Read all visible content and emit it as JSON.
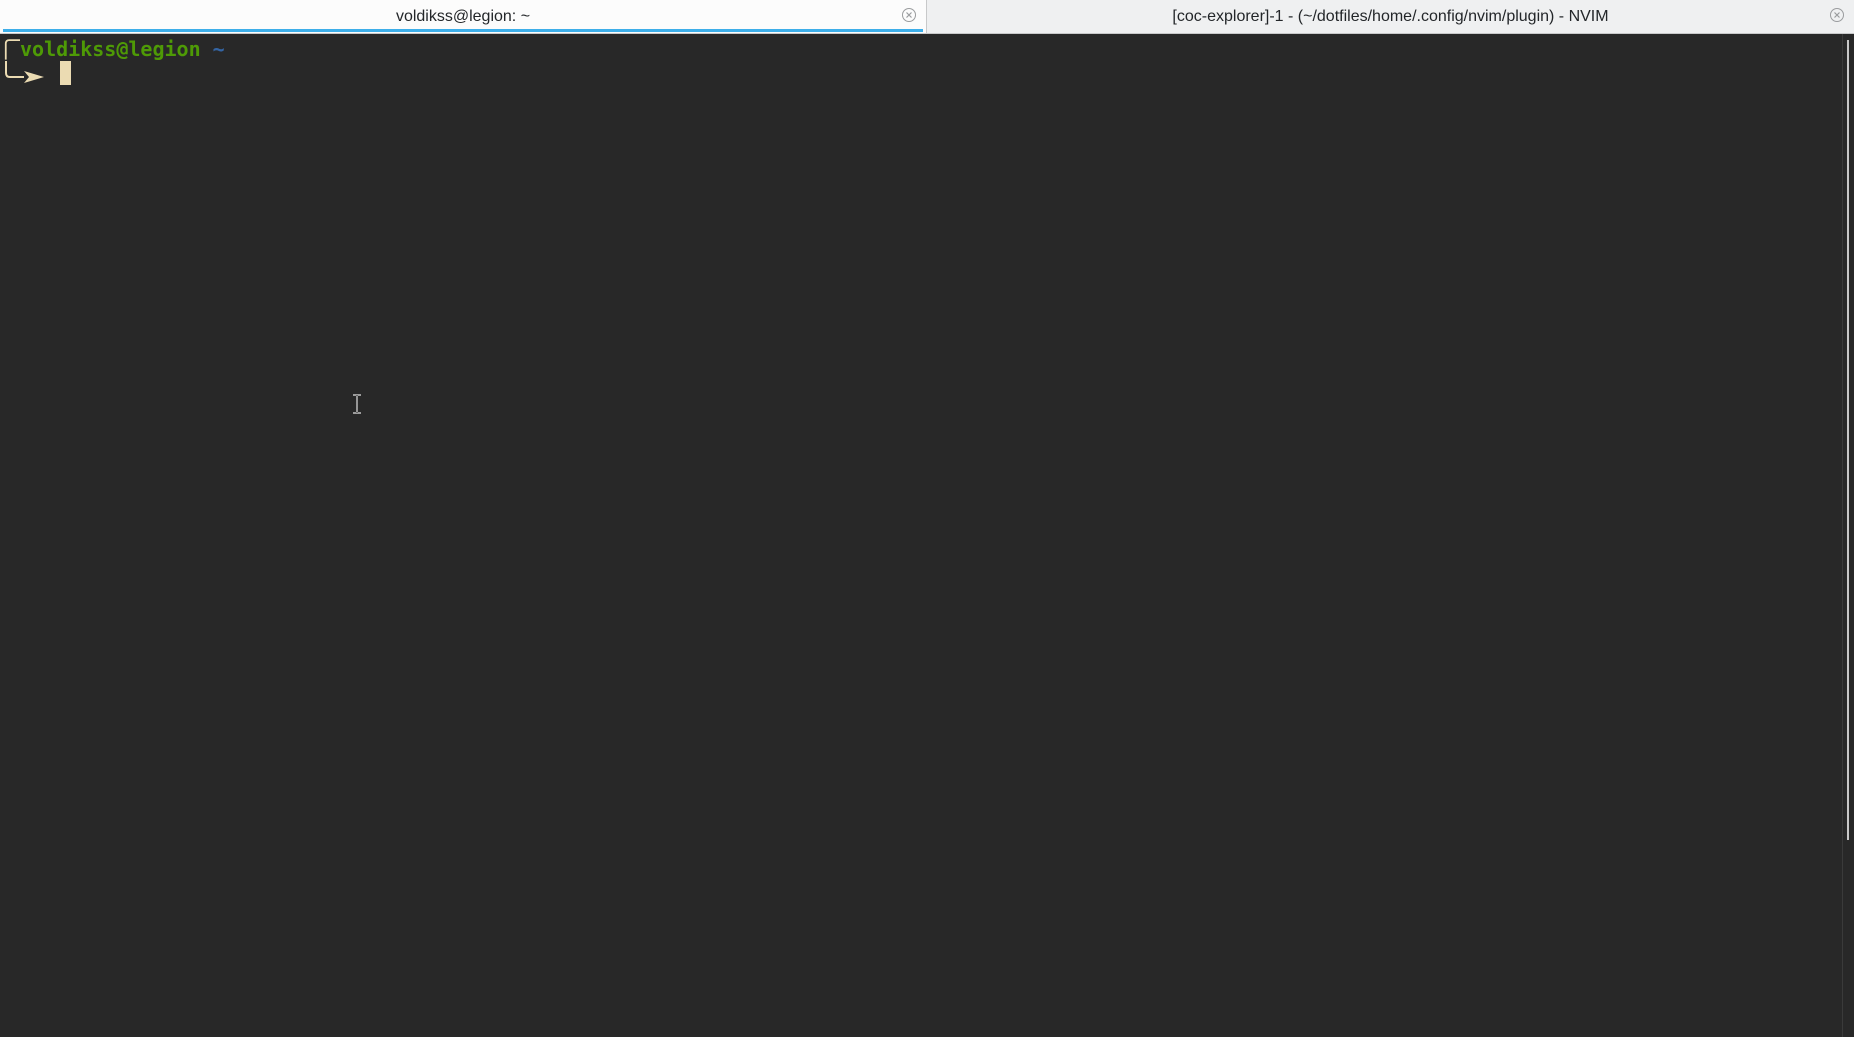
{
  "tabs": [
    {
      "title": "voldikss@legion: ~",
      "active": true
    },
    {
      "title": "[coc-explorer]-1 - (~/dotfiles/home/.config/nvim/plugin) - NVIM",
      "active": false
    }
  ],
  "prompt": {
    "user": "voldikss",
    "at": "@",
    "host": "legion",
    "path": "~"
  },
  "icons": {
    "tab_close": "close-circle-icon",
    "prompt_arrow": "arrow-right-icon",
    "mouse_cursor": "ibeam-cursor-icon"
  },
  "colors": {
    "terminal_bg": "#282828",
    "user_host": "#4e9a06",
    "path": "#3465a4",
    "active_tab_indicator": "#3daee9",
    "cursor": "#ebdbb2"
  }
}
